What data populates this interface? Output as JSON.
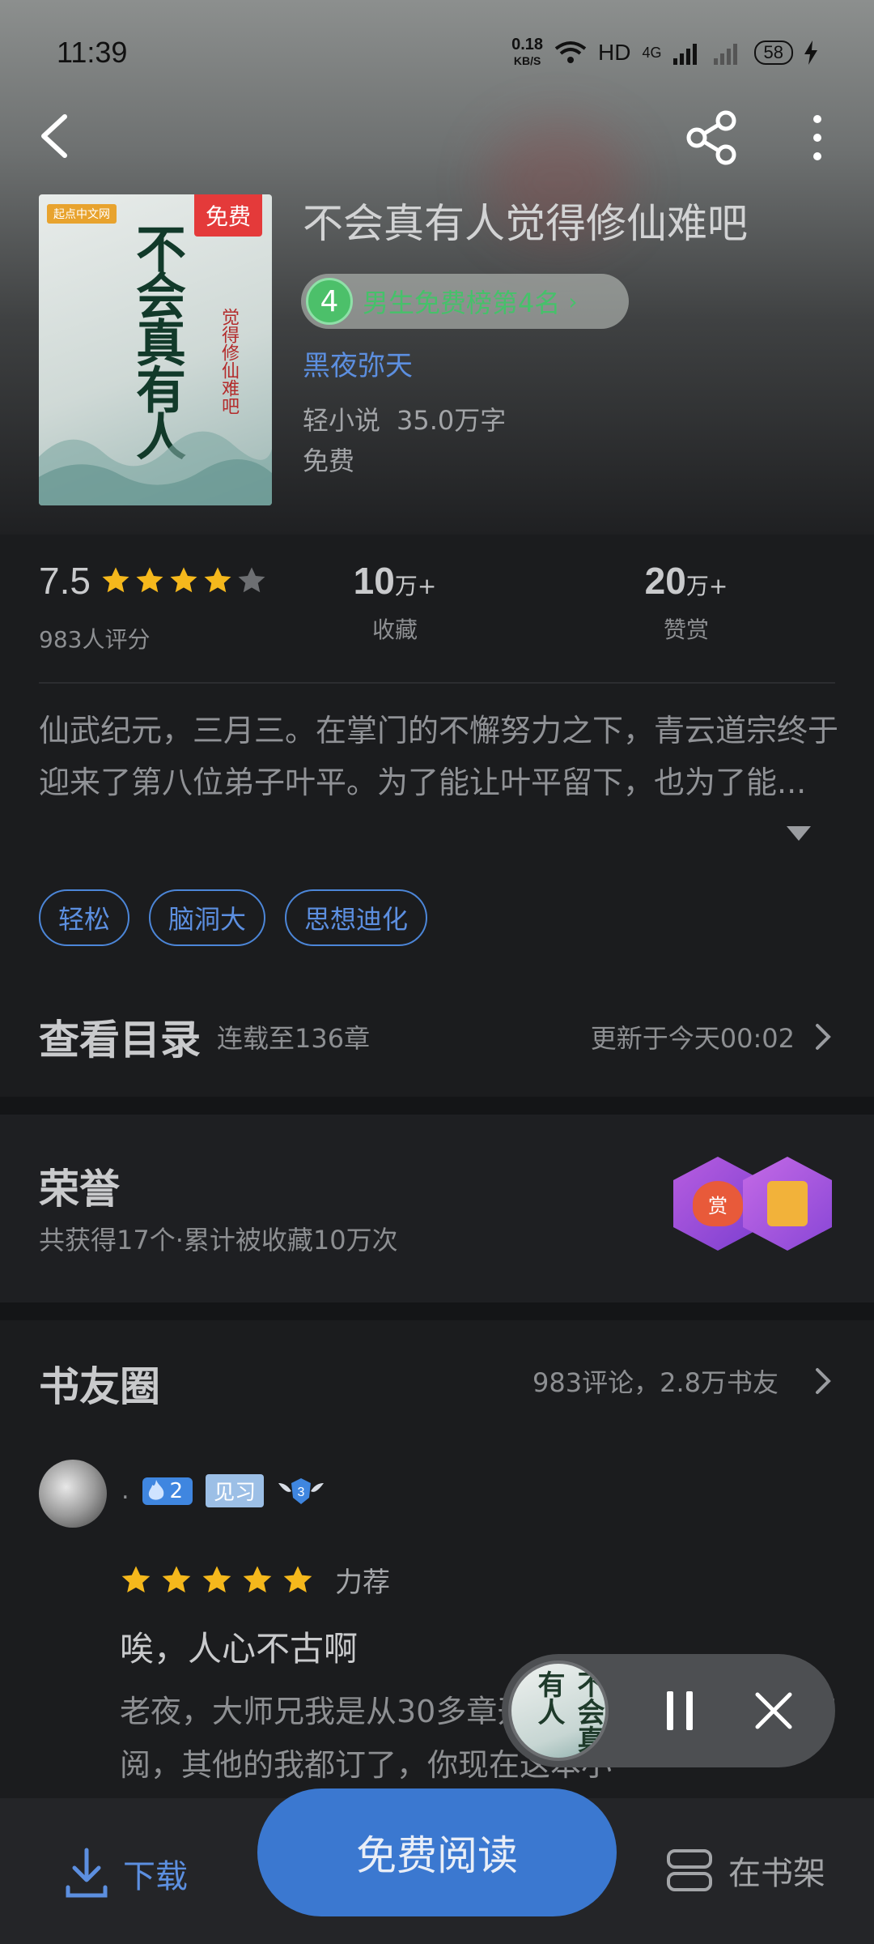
{
  "status": {
    "time": "11:39",
    "net_speed_value": "0.18",
    "net_speed_unit": "KB/S",
    "hd": "HD",
    "signal": "4G",
    "battery": "58"
  },
  "book": {
    "title": "不会真有人觉得修仙难吧",
    "cover_badge": "免费",
    "cover_brand": "起点中文网",
    "cover_title": "不会真有人",
    "cover_subtitle": "觉得修仙难吧",
    "rank_number": "4",
    "rank_text": "男生免费榜第4名",
    "rank_arrow": "›",
    "author": "黑夜弥天",
    "category": "轻小说",
    "word_count": "35.0万字",
    "price": "免费"
  },
  "stats": {
    "rating": "7.5",
    "rating_count": "983人评分",
    "stars_filled": 4,
    "collect_num": "10",
    "collect_unit": "万+",
    "collect_label": "收藏",
    "reward_num": "20",
    "reward_unit": "万+",
    "reward_label": "赞赏"
  },
  "synopsis": "仙武纪元，三月三。在掌门的不懈努力之下，青云道宗终于迎来了第八位弟子叶平。为了能让叶平留下，也为了能...",
  "tags": [
    "轻松",
    "脑洞大",
    "思想迪化"
  ],
  "catalog": {
    "title": "查看目录",
    "status": "连载至136章",
    "update": "更新于今天00:02"
  },
  "honor": {
    "title": "荣誉",
    "desc": "共获得17个·累计被收藏10万次",
    "badge1_text": "赏"
  },
  "circle": {
    "title": "书友圈",
    "meta": "983评论，2.8万书友",
    "user_dot": ".",
    "fire_level": "2",
    "level_label": "见习",
    "shield_level": "3",
    "review_rating_label": "力荐",
    "review_title": "唉，人心不古啊",
    "review_body": "老夜，大师兄我是从30多章开始的，后面几十章没订阅，其他的我都订了，你现在这本小"
  },
  "floater": {
    "thumb_text": "不会真有人"
  },
  "bottom": {
    "download": "下载",
    "read": "免费阅读",
    "shelf": "在书架"
  },
  "colors": {
    "accent_blue": "#3b78d0",
    "link_blue": "#5c8fe0",
    "rank_green": "#46c16a",
    "star_gold": "#f5b81c",
    "badge_red": "#e43a3a"
  }
}
